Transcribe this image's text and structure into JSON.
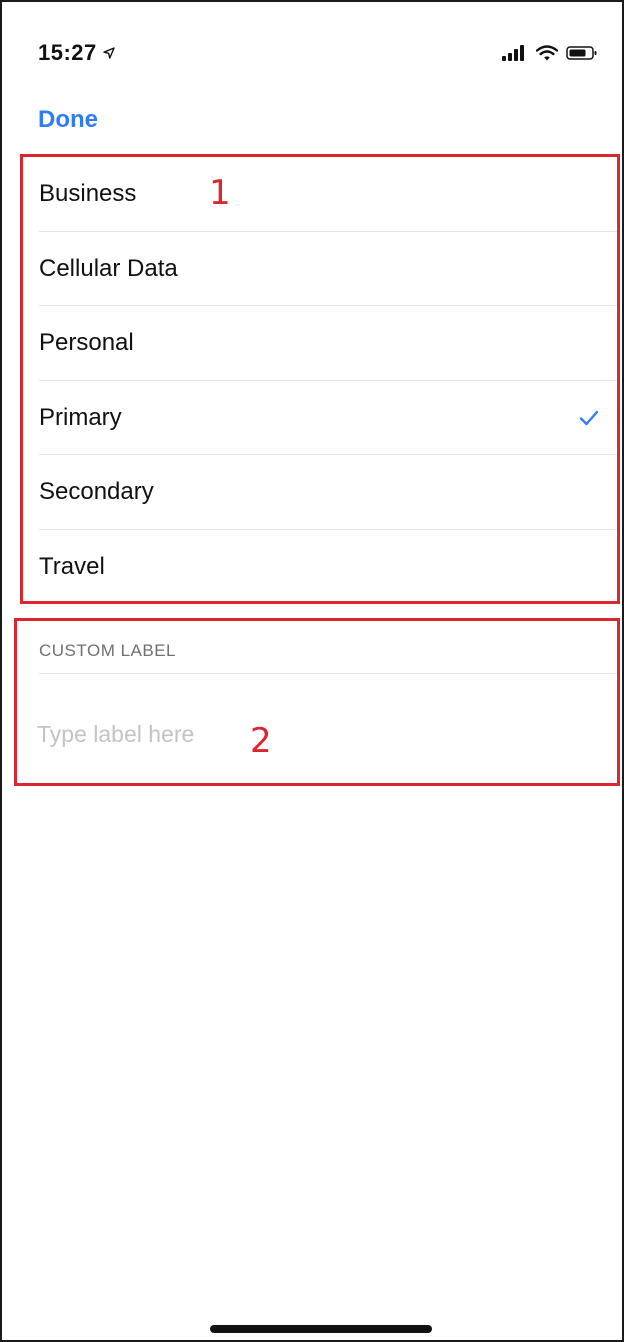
{
  "status_bar": {
    "time": "15:27",
    "location_icon": "location-arrow-icon",
    "signal_icon": "cellular-signal-icon",
    "wifi_icon": "wifi-icon",
    "battery_icon": "battery-icon"
  },
  "nav": {
    "done_label": "Done"
  },
  "options": {
    "items": [
      {
        "label": "Business",
        "selected": false
      },
      {
        "label": "Cellular Data",
        "selected": false
      },
      {
        "label": "Personal",
        "selected": false
      },
      {
        "label": "Primary",
        "selected": true
      },
      {
        "label": "Secondary",
        "selected": false
      },
      {
        "label": "Travel",
        "selected": false
      }
    ],
    "annotation": "1"
  },
  "custom_label": {
    "header": "CUSTOM LABEL",
    "placeholder": "Type label here",
    "value": "",
    "annotation": "2"
  },
  "colors": {
    "accent": "#2f7cf6",
    "annotation_border": "#d9262f"
  }
}
